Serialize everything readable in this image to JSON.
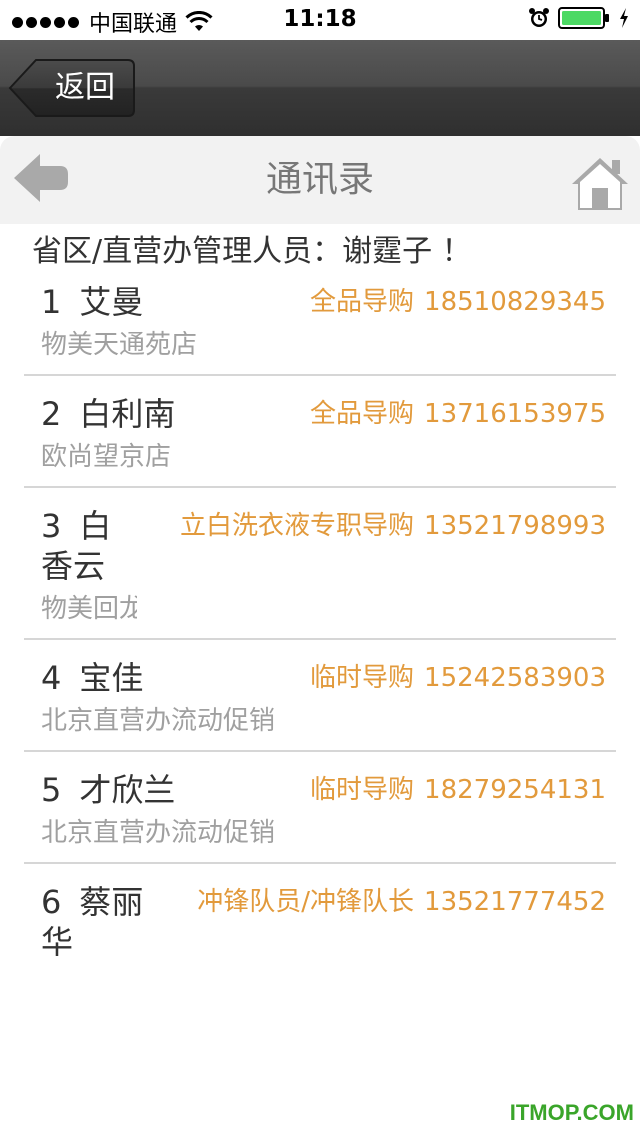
{
  "status_bar": {
    "carrier": "中国联通",
    "time": "11:18"
  },
  "nav": {
    "back_label": "返回"
  },
  "header": {
    "title": "通讯录"
  },
  "manager_text": "省区/直营办管理人员：谢霆子 ！",
  "contacts": [
    {
      "num": "1",
      "name": "艾曼",
      "role": "全品导购",
      "phone": "18510829345",
      "store": "物美天通苑店"
    },
    {
      "num": "2",
      "name": "白利南",
      "role": "全品导购",
      "phone": "13716153975",
      "store": "欧尚望京店"
    },
    {
      "num": "3",
      "name_line1": "白",
      "name_line2": "香云",
      "role": "立白洗衣液专职导购",
      "phone": "13521798993",
      "store": "物美回龙"
    },
    {
      "num": "4",
      "name": "宝佳",
      "role": "临时导购",
      "phone": "15242583903",
      "store": "北京直营办流动促销"
    },
    {
      "num": "5",
      "name": "才欣兰",
      "role": "临时导购",
      "phone": "18279254131",
      "store": "北京直营办流动促销"
    },
    {
      "num": "6",
      "name_line1": "蔡丽",
      "name_line2": "华",
      "role": "冲锋队员/冲锋队长",
      "phone": "13521777452"
    }
  ],
  "watermark": "ITMOP.COM",
  "colors": {
    "accent": "#e29a3c",
    "battery": "#4cd964",
    "watermark": "#3aa52a"
  }
}
